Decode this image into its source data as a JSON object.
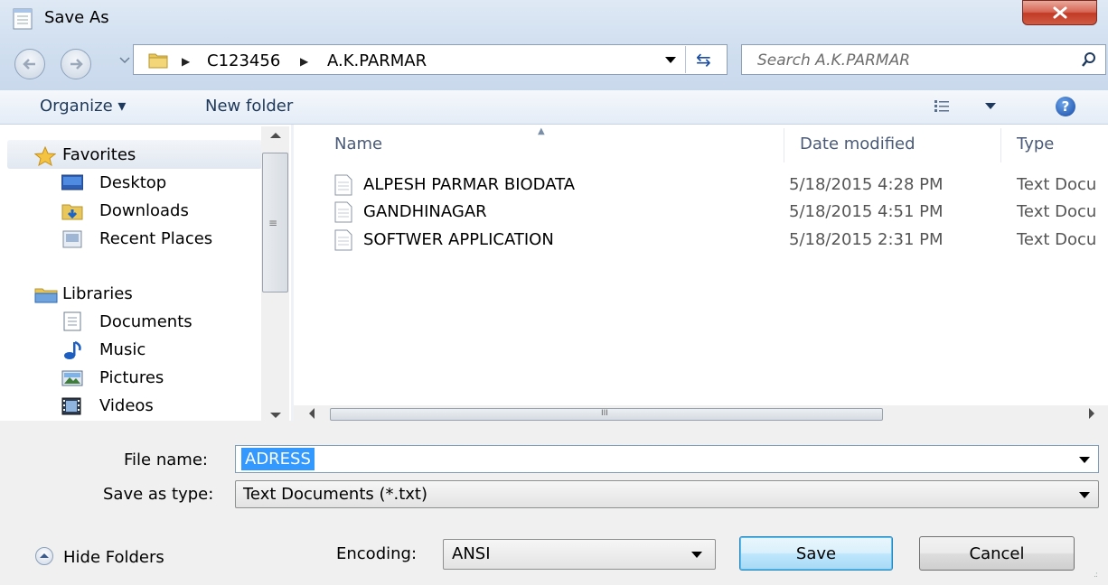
{
  "window": {
    "title": "Save As"
  },
  "address_bar": {
    "crumbs": [
      "C123456",
      "A.K.PARMAR"
    ]
  },
  "search": {
    "placeholder": "Search A.K.PARMAR"
  },
  "toolbar": {
    "organize": "Organize ▾",
    "new_folder": "New folder"
  },
  "sidebar": {
    "favorites": {
      "label": "Favorites",
      "items": [
        "Desktop",
        "Downloads",
        "Recent Places"
      ]
    },
    "libraries": {
      "label": "Libraries",
      "items": [
        "Documents",
        "Music",
        "Pictures",
        "Videos"
      ]
    }
  },
  "file_list": {
    "columns": [
      "Name",
      "Date modified",
      "Type"
    ],
    "files": [
      {
        "name": "ALPESH PARMAR BIODATA",
        "date": "5/18/2015 4:28 PM",
        "type": "Text Docu"
      },
      {
        "name": "GANDHINAGAR",
        "date": "5/18/2015 4:51 PM",
        "type": "Text Docu"
      },
      {
        "name": "SOFTWER APPLICATION",
        "date": "5/18/2015 2:31 PM",
        "type": "Text Docu"
      }
    ],
    "hscroll_grip": "III"
  },
  "form": {
    "file_name_label": "File name:",
    "file_name_value": "ADRESS",
    "save_type_label": "Save as type:",
    "save_type_value": "Text Documents (*.txt)",
    "encoding_label": "Encoding:",
    "encoding_value": "ANSI"
  },
  "buttons": {
    "save": "Save",
    "cancel": "Cancel",
    "hide_folders": "Hide Folders"
  },
  "icons": {
    "close": "close-icon",
    "back": "back-arrow-icon",
    "forward": "forward-arrow-icon",
    "refresh": "refresh-icon",
    "search": "search-icon",
    "help": "help-icon",
    "view": "view-options-icon",
    "file": "text-file-icon",
    "star": "star-icon"
  },
  "colors": {
    "selection": "#3399ff",
    "chrome": "#d2e0f0",
    "close_button": "#c8432e"
  }
}
